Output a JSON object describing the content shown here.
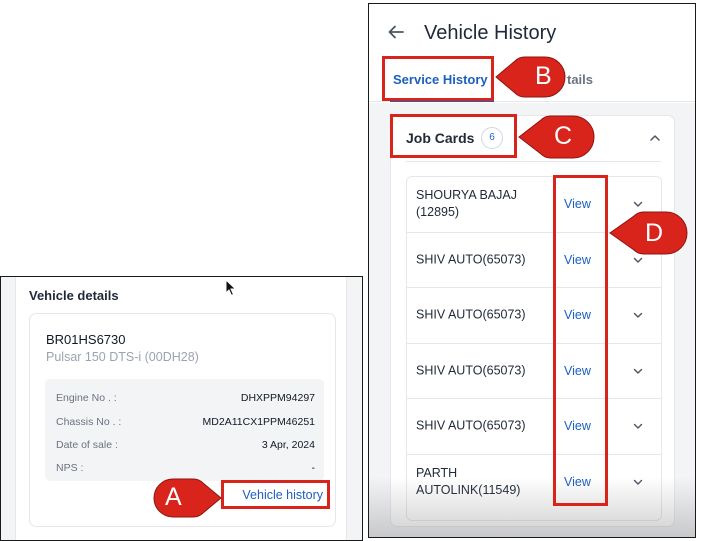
{
  "vehicle_details": {
    "title": "Vehicle details",
    "registration": "BR01HS6730",
    "model": "Pulsar 150 DTS-i (00DH28)",
    "specs": [
      {
        "label": "Engine No . :",
        "value": "DHXPPM94297"
      },
      {
        "label": "Chassis No . :",
        "value": "MD2A11CX1PPM46251"
      },
      {
        "label": "Date of sale :",
        "value": "3 Apr, 2024"
      },
      {
        "label": "NPS :",
        "value": "-"
      }
    ],
    "history_link": "Vehicle history"
  },
  "vehicle_history": {
    "title": "Vehicle History",
    "back_icon": "arrow-left-icon",
    "tabs": [
      {
        "label": "Service History",
        "active": true
      },
      {
        "label": "tails",
        "active": false
      }
    ],
    "job_cards": {
      "title": "Job Cards",
      "count": "6",
      "rows": [
        {
          "name": "SHOURYA BAJAJ (12895)",
          "action": "View"
        },
        {
          "name": "SHIV AUTO(65073)",
          "action": "View"
        },
        {
          "name": "SHIV AUTO(65073)",
          "action": "View"
        },
        {
          "name": "SHIV AUTO(65073)",
          "action": "View"
        },
        {
          "name": "SHIV AUTO(65073)",
          "action": "View"
        },
        {
          "name": "PARTH AUTOLINK(11549)",
          "action": "View"
        }
      ]
    }
  },
  "annotations": {
    "a": "A",
    "b": "B",
    "c": "C",
    "d": "D"
  },
  "colors": {
    "accent": "#1d5fbf",
    "annotation": "#d9241c"
  }
}
